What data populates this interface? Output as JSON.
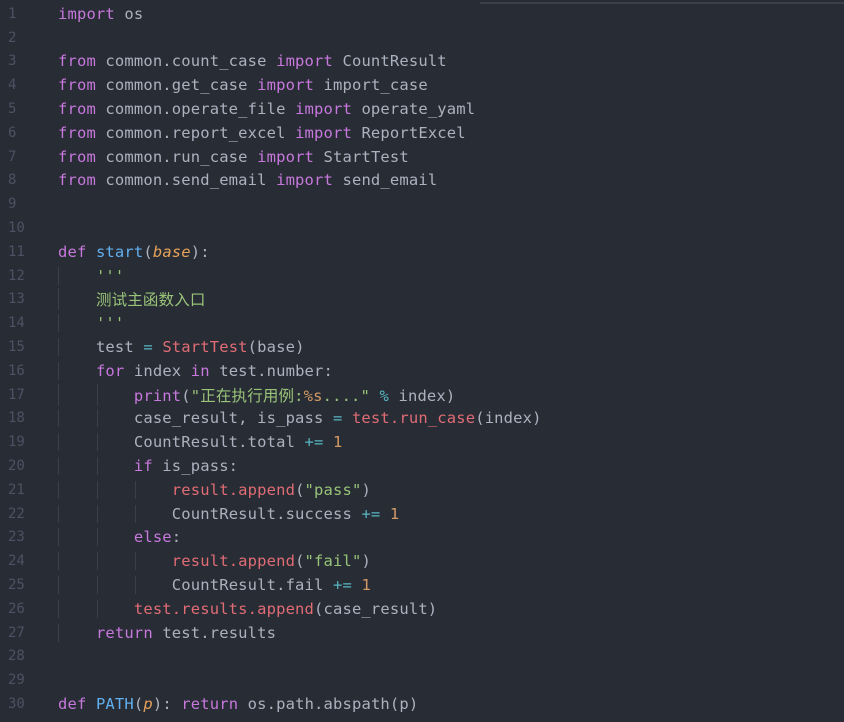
{
  "editor": {
    "language": "python",
    "lines": [
      {
        "n": "1",
        "indent": 0,
        "tokens": [
          {
            "t": "import",
            "c": "kw"
          },
          {
            "t": " os",
            "c": "pl"
          }
        ]
      },
      {
        "n": "2",
        "indent": 0,
        "tokens": []
      },
      {
        "n": "3",
        "indent": 0,
        "tokens": [
          {
            "t": "from",
            "c": "kw"
          },
          {
            "t": " common.count_case ",
            "c": "pl"
          },
          {
            "t": "import",
            "c": "kw"
          },
          {
            "t": " CountResult",
            "c": "pl"
          }
        ]
      },
      {
        "n": "4",
        "indent": 0,
        "tokens": [
          {
            "t": "from",
            "c": "kw"
          },
          {
            "t": " common.get_case ",
            "c": "pl"
          },
          {
            "t": "import",
            "c": "kw"
          },
          {
            "t": " import_case",
            "c": "pl"
          }
        ]
      },
      {
        "n": "5",
        "indent": 0,
        "tokens": [
          {
            "t": "from",
            "c": "kw"
          },
          {
            "t": " common.operate_file ",
            "c": "pl"
          },
          {
            "t": "import",
            "c": "kw"
          },
          {
            "t": " operate_yaml",
            "c": "pl"
          }
        ]
      },
      {
        "n": "6",
        "indent": 0,
        "tokens": [
          {
            "t": "from",
            "c": "kw"
          },
          {
            "t": " common.report_excel ",
            "c": "pl"
          },
          {
            "t": "import",
            "c": "kw"
          },
          {
            "t": " ReportExcel",
            "c": "pl"
          }
        ]
      },
      {
        "n": "7",
        "indent": 0,
        "tokens": [
          {
            "t": "from",
            "c": "kw"
          },
          {
            "t": " common.run_case ",
            "c": "pl"
          },
          {
            "t": "import",
            "c": "kw"
          },
          {
            "t": " StartTest",
            "c": "pl"
          }
        ]
      },
      {
        "n": "8",
        "indent": 0,
        "tokens": [
          {
            "t": "from",
            "c": "kw"
          },
          {
            "t": " common.send_email ",
            "c": "pl"
          },
          {
            "t": "import",
            "c": "kw"
          },
          {
            "t": " send_email",
            "c": "pl"
          }
        ]
      },
      {
        "n": "9",
        "indent": 0,
        "tokens": []
      },
      {
        "n": "10",
        "indent": 0,
        "tokens": []
      },
      {
        "n": "11",
        "indent": 0,
        "tokens": [
          {
            "t": "def",
            "c": "kw"
          },
          {
            "t": " ",
            "c": "pl"
          },
          {
            "t": "start",
            "c": "fn"
          },
          {
            "t": "(",
            "c": "pl"
          },
          {
            "t": "base",
            "c": "param"
          },
          {
            "t": "):",
            "c": "pl"
          }
        ]
      },
      {
        "n": "12",
        "indent": 1,
        "tokens": [
          {
            "t": "'''",
            "c": "str"
          }
        ]
      },
      {
        "n": "13",
        "indent": 1,
        "tokens": [
          {
            "t": "测试主函数入口",
            "c": "str"
          }
        ]
      },
      {
        "n": "14",
        "indent": 1,
        "tokens": [
          {
            "t": "'''",
            "c": "str"
          }
        ]
      },
      {
        "n": "15",
        "indent": 1,
        "tokens": [
          {
            "t": "test ",
            "c": "pl"
          },
          {
            "t": "=",
            "c": "op"
          },
          {
            "t": " ",
            "c": "pl"
          },
          {
            "t": "StartTest",
            "c": "call"
          },
          {
            "t": "(base)",
            "c": "pl"
          }
        ]
      },
      {
        "n": "16",
        "indent": 1,
        "tokens": [
          {
            "t": "for",
            "c": "kw"
          },
          {
            "t": " index ",
            "c": "pl"
          },
          {
            "t": "in",
            "c": "kw"
          },
          {
            "t": " test.number:",
            "c": "pl"
          }
        ]
      },
      {
        "n": "17",
        "indent": 2,
        "tokens": [
          {
            "t": "print",
            "c": "kw"
          },
          {
            "t": "(",
            "c": "pl"
          },
          {
            "t": "\"正在执行用例:",
            "c": "str"
          },
          {
            "t": "%s",
            "c": "num"
          },
          {
            "t": "....\"",
            "c": "str"
          },
          {
            "t": " ",
            "c": "pl"
          },
          {
            "t": "%",
            "c": "op"
          },
          {
            "t": " index)",
            "c": "pl"
          }
        ]
      },
      {
        "n": "18",
        "indent": 2,
        "tokens": [
          {
            "t": "case_result, is_pass ",
            "c": "pl"
          },
          {
            "t": "=",
            "c": "op"
          },
          {
            "t": " ",
            "c": "pl"
          },
          {
            "t": "test.run_case",
            "c": "call"
          },
          {
            "t": "(index)",
            "c": "pl"
          }
        ]
      },
      {
        "n": "19",
        "indent": 2,
        "tokens": [
          {
            "t": "CountResult.total ",
            "c": "pl"
          },
          {
            "t": "+=",
            "c": "op"
          },
          {
            "t": " ",
            "c": "pl"
          },
          {
            "t": "1",
            "c": "num"
          }
        ]
      },
      {
        "n": "20",
        "indent": 2,
        "tokens": [
          {
            "t": "if",
            "c": "kw"
          },
          {
            "t": " is_pass:",
            "c": "pl"
          }
        ]
      },
      {
        "n": "21",
        "indent": 3,
        "tokens": [
          {
            "t": "result.append",
            "c": "call"
          },
          {
            "t": "(",
            "c": "pl"
          },
          {
            "t": "\"pass\"",
            "c": "str"
          },
          {
            "t": ")",
            "c": "pl"
          }
        ]
      },
      {
        "n": "22",
        "indent": 3,
        "tokens": [
          {
            "t": "CountResult.success ",
            "c": "pl"
          },
          {
            "t": "+=",
            "c": "op"
          },
          {
            "t": " ",
            "c": "pl"
          },
          {
            "t": "1",
            "c": "num"
          }
        ]
      },
      {
        "n": "23",
        "indent": 2,
        "tokens": [
          {
            "t": "else",
            "c": "kw"
          },
          {
            "t": ":",
            "c": "pl"
          }
        ]
      },
      {
        "n": "24",
        "indent": 3,
        "tokens": [
          {
            "t": "result.append",
            "c": "call"
          },
          {
            "t": "(",
            "c": "pl"
          },
          {
            "t": "\"fail\"",
            "c": "str"
          },
          {
            "t": ")",
            "c": "pl"
          }
        ]
      },
      {
        "n": "25",
        "indent": 3,
        "tokens": [
          {
            "t": "CountResult.fail ",
            "c": "pl"
          },
          {
            "t": "+=",
            "c": "op"
          },
          {
            "t": " ",
            "c": "pl"
          },
          {
            "t": "1",
            "c": "num"
          }
        ]
      },
      {
        "n": "26",
        "indent": 2,
        "tokens": [
          {
            "t": "test.results.append",
            "c": "call"
          },
          {
            "t": "(case_result)",
            "c": "pl"
          }
        ]
      },
      {
        "n": "27",
        "indent": 1,
        "tokens": [
          {
            "t": "return",
            "c": "kw"
          },
          {
            "t": " test.results",
            "c": "pl"
          }
        ]
      },
      {
        "n": "28",
        "indent": 0,
        "tokens": []
      },
      {
        "n": "29",
        "indent": 0,
        "tokens": []
      },
      {
        "n": "30",
        "indent": 0,
        "tokens": [
          {
            "t": "def",
            "c": "kw"
          },
          {
            "t": " ",
            "c": "pl"
          },
          {
            "t": "PATH",
            "c": "fn"
          },
          {
            "t": "(",
            "c": "pl"
          },
          {
            "t": "p",
            "c": "param"
          },
          {
            "t": "): ",
            "c": "pl"
          },
          {
            "t": "return",
            "c": "kw"
          },
          {
            "t": " os.path.abspath(p)",
            "c": "pl"
          }
        ]
      }
    ]
  },
  "theme": {
    "background": "#282c34",
    "keyword": "#c678dd",
    "function": "#61afef",
    "string": "#98c379",
    "number": "#d19a66",
    "call": "#e06c75"
  }
}
